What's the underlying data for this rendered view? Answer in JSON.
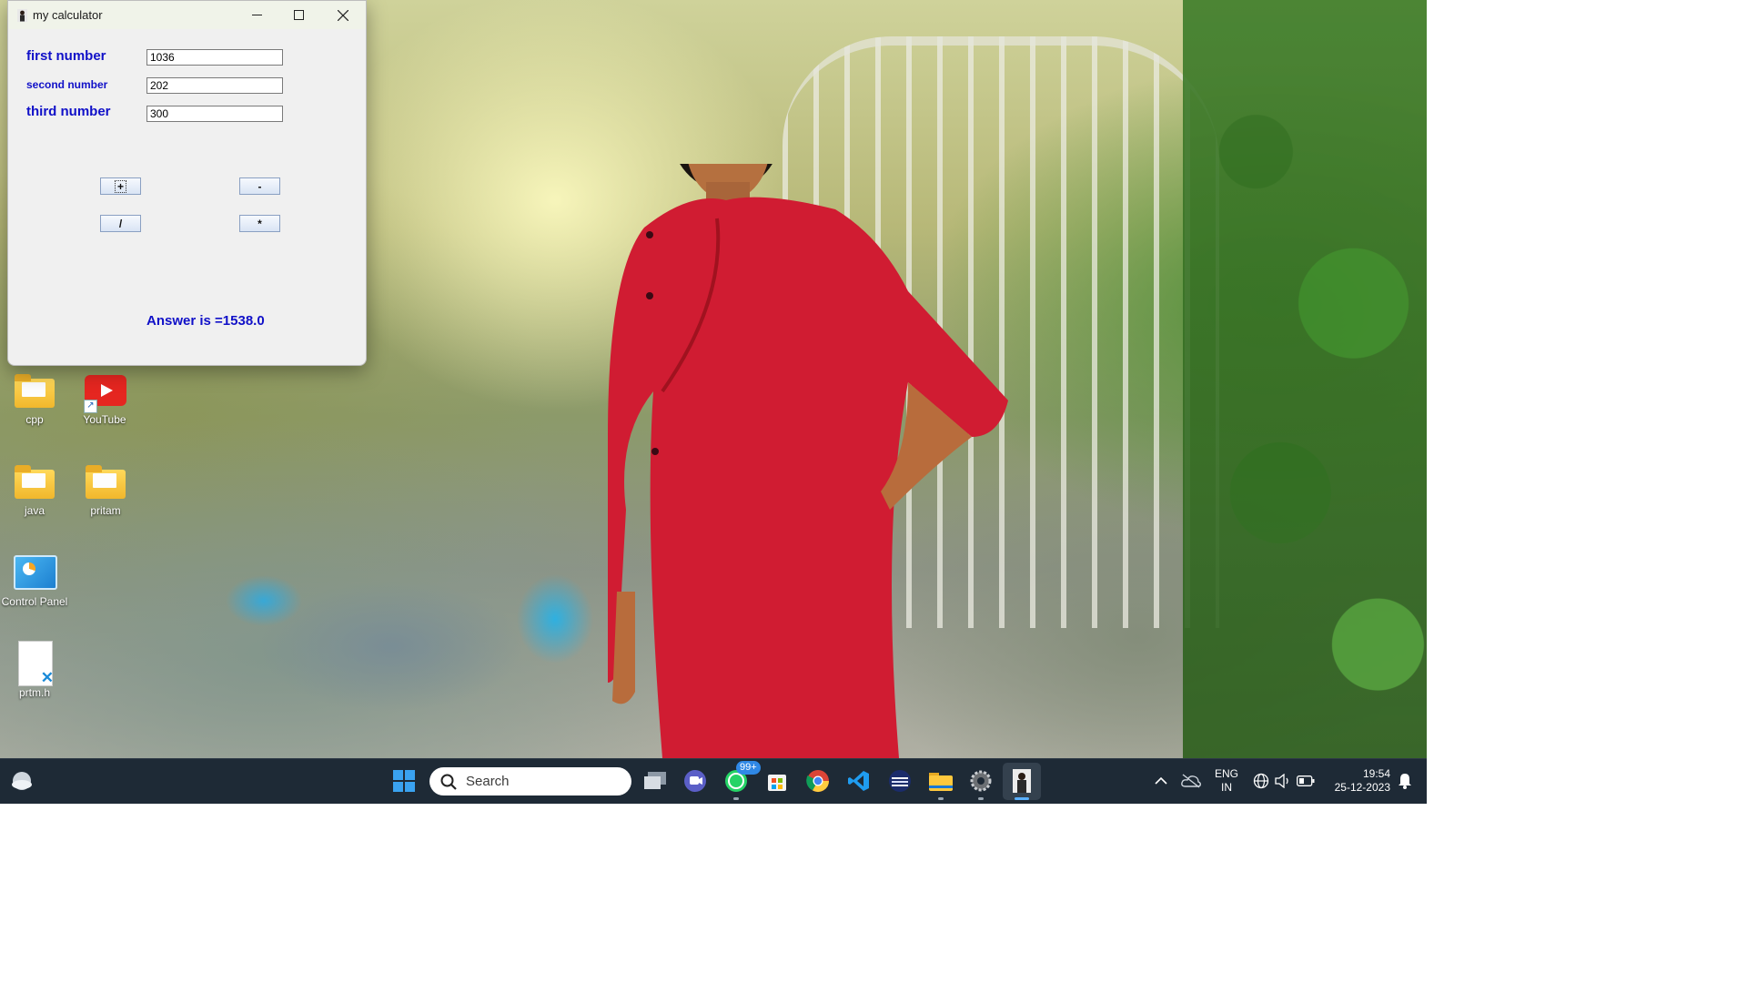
{
  "window": {
    "title": "my calculator",
    "labels": {
      "first": "first number",
      "second": "second number",
      "third": "third number"
    },
    "inputs": {
      "first": "1036",
      "second": "202",
      "third": "300"
    },
    "buttons": {
      "add": "+",
      "subtract": "-",
      "divide": "/",
      "multiply": "*"
    },
    "answer": "Answer is =1538.0",
    "colors": {
      "label": "#1010c8",
      "background": "#f0f0f0"
    }
  },
  "desktop": {
    "icons": [
      {
        "label": "cpp",
        "icon": "folder-icon"
      },
      {
        "label": "YouTube",
        "icon": "youtube-icon"
      },
      {
        "label": "java",
        "icon": "folder-icon"
      },
      {
        "label": "pritam",
        "icon": "folder-icon"
      },
      {
        "label": "Control Panel",
        "icon": "control-panel-icon"
      },
      {
        "label": "prtm.h",
        "icon": "vscode-file-icon"
      }
    ]
  },
  "taskbar": {
    "search_placeholder": "Search",
    "apps": [
      "start-icon",
      "task-view-icon",
      "teams-chat-icon",
      "whatsapp-icon",
      "microsoft-store-icon",
      "chrome-icon",
      "vscode-icon",
      "app-icon",
      "file-explorer-icon",
      "settings-icon",
      "calculator-app-icon"
    ],
    "whatsapp_badge": "99+",
    "language_line1": "ENG",
    "language_line2": "IN",
    "time": "19:54",
    "date": "25-12-2023"
  }
}
